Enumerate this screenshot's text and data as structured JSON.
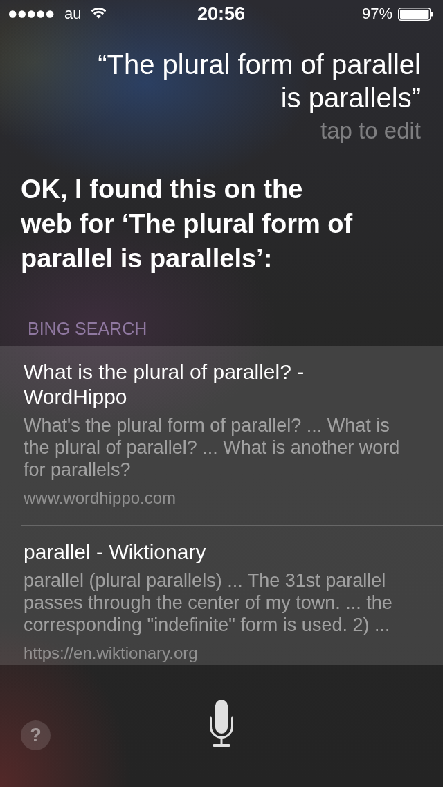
{
  "status_bar": {
    "carrier": "au",
    "time": "20:56",
    "battery_percent": "97%"
  },
  "query": {
    "text": "“The plural form of parallel is parallels”",
    "edit_hint": "tap to edit"
  },
  "response": "OK, I found this on the web for ‘The plural form of parallel is parallels’:",
  "results_section": {
    "title": "BING SEARCH",
    "results": [
      {
        "title": "What is the plural of parallel? - WordHippo",
        "snippet": "What's the plural form of parallel? ... What is the plural of parallel? ... What is another word for parallels?",
        "url": "www.wordhippo.com"
      },
      {
        "title": "parallel - Wiktionary",
        "snippet": "parallel (plural parallels) ... The 31st parallel passes through the center of my town. ... the corresponding \"indefinite\" form is used. 2) ...",
        "url": "https://en.wiktionary.org"
      }
    ]
  },
  "help_button": {
    "label": "?"
  }
}
